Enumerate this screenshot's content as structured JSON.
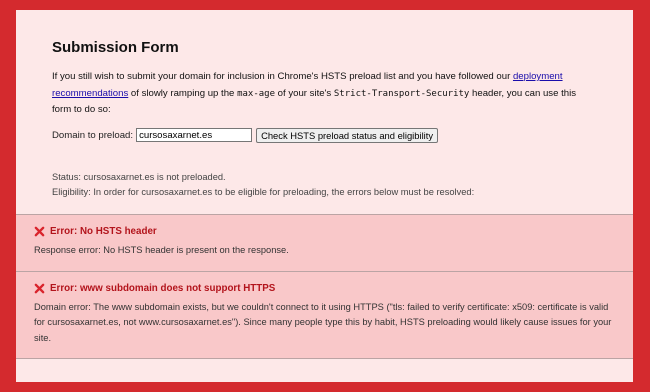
{
  "page": {
    "title": "Submission Form",
    "intro": {
      "part1": "If you still wish to submit your domain for inclusion in Chrome's HSTS preload list and you have followed our ",
      "link": "deployment recommendations",
      "part2": " of slowly ramping up the ",
      "code1": "max-age",
      "part3": " of your site's ",
      "code2": "Strict-Transport-Security",
      "part4": " header, you can use this form to do so:"
    },
    "form": {
      "label": "Domain to preload:",
      "value": "cursosaxarnet.es",
      "button": "Check HSTS preload status and eligibility"
    },
    "status": "Status: cursosaxarnet.es is not preloaded.",
    "eligibility": "Eligibility: In order for cursosaxarnet.es to be eligible for preloading, the errors below must be resolved:",
    "errors": [
      {
        "icon": "x-icon",
        "title": "Error: No HSTS header",
        "message": "Response error: No HSTS header is present on the response."
      },
      {
        "icon": "x-icon",
        "title": "Error: www subdomain does not support HTTPS",
        "message": "Domain error: The www subdomain exists, but we couldn't connect to it using HTTPS (\"tls: failed to verify certificate: x509: certificate is valid for cursosaxarnet.es, not www.cursosaxarnet.es\"). Since many people type this by habit, HSTS preloading would likely cause issues for your site."
      }
    ]
  },
  "colors": {
    "background": "#d42a2e",
    "panel": "#fde8e8",
    "error_bg": "#f9c8c9",
    "error_title": "#b3141c",
    "link": "#1a0dab"
  }
}
